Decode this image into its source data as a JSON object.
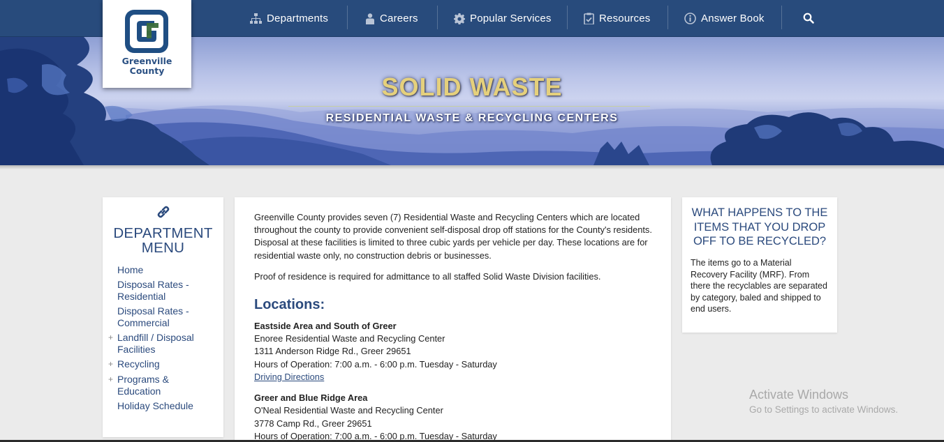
{
  "brand": {
    "name_line1": "Greenville",
    "name_line2": "County",
    "logo_letter": "G",
    "colors": {
      "navy": "#284b7c",
      "logo_blue": "#1f4e83",
      "logo_green": "#3b6d3a",
      "gold": "#e5d07c",
      "link": "#2b4a7d"
    }
  },
  "nav": {
    "items": [
      {
        "label": "Departments",
        "icon": "org-chart-icon"
      },
      {
        "label": "Careers",
        "icon": "person-icon"
      },
      {
        "label": "Popular Services",
        "icon": "gear-icon"
      },
      {
        "label": "Resources",
        "icon": "clipboard-check-icon"
      },
      {
        "label": "Answer Book",
        "icon": "info-icon"
      }
    ],
    "search_icon": "search-icon"
  },
  "hero": {
    "title": "SOLID WASTE",
    "subtitle": "RESIDENTIAL WASTE & RECYCLING CENTERS"
  },
  "dept_menu": {
    "icon": "link-icon",
    "title_line1": "DEPARTMENT",
    "title_line2": "MENU",
    "items": [
      {
        "label": "Home",
        "expandable": false
      },
      {
        "label": "Disposal Rates - Residential",
        "expandable": false
      },
      {
        "label": "Disposal Rates - Commercial",
        "expandable": false
      },
      {
        "label": "Landfill / Disposal Facilities",
        "expandable": true
      },
      {
        "label": "Recycling",
        "expandable": true
      },
      {
        "label": "Programs & Education",
        "expandable": true
      },
      {
        "label": "Holiday Schedule",
        "expandable": false
      }
    ],
    "expand_symbol": "+"
  },
  "main": {
    "intro_1": "Greenville County provides seven (7) Residential Waste and Recycling Centers which are located throughout the county to provide convenient self-disposal drop off stations for the County's residents. Disposal at these facilities is limited to three cubic yards per vehicle per day. These locations are for residential waste only, no construction debris or businesses.",
    "intro_2": "Proof of residence is required for admittance to all staffed Solid Waste Division facilities.",
    "locations_heading": "Locations:",
    "locations": [
      {
        "area": "Eastside Area and South of Greer",
        "center": "Enoree Residential Waste and Recycling Center",
        "address": "1311 Anderson Ridge Rd., Greer 29651",
        "hours": "Hours of Operation: 7:00 a.m. - 6:00 p.m. Tuesday - Saturday",
        "directions": "Driving Directions"
      },
      {
        "area": "Greer and Blue Ridge Area",
        "center": "O'Neal Residential Waste and Recycling Center",
        "address": "3778 Camp Rd., Greer 29651",
        "hours": "Hours of Operation: 7:00 a.m. - 6:00 p.m. Tuesday - Saturday"
      }
    ]
  },
  "sidebar": {
    "title": "WHAT HAPPENS TO THE ITEMS THAT YOU DROP OFF TO BE RECYCLED?",
    "text": "The items go to a Material Recovery Facility (MRF). From there the recyclables are separated by category, baled and shipped to end users."
  },
  "watermark": {
    "title": "Activate Windows",
    "subtitle": "Go to Settings to activate Windows."
  }
}
